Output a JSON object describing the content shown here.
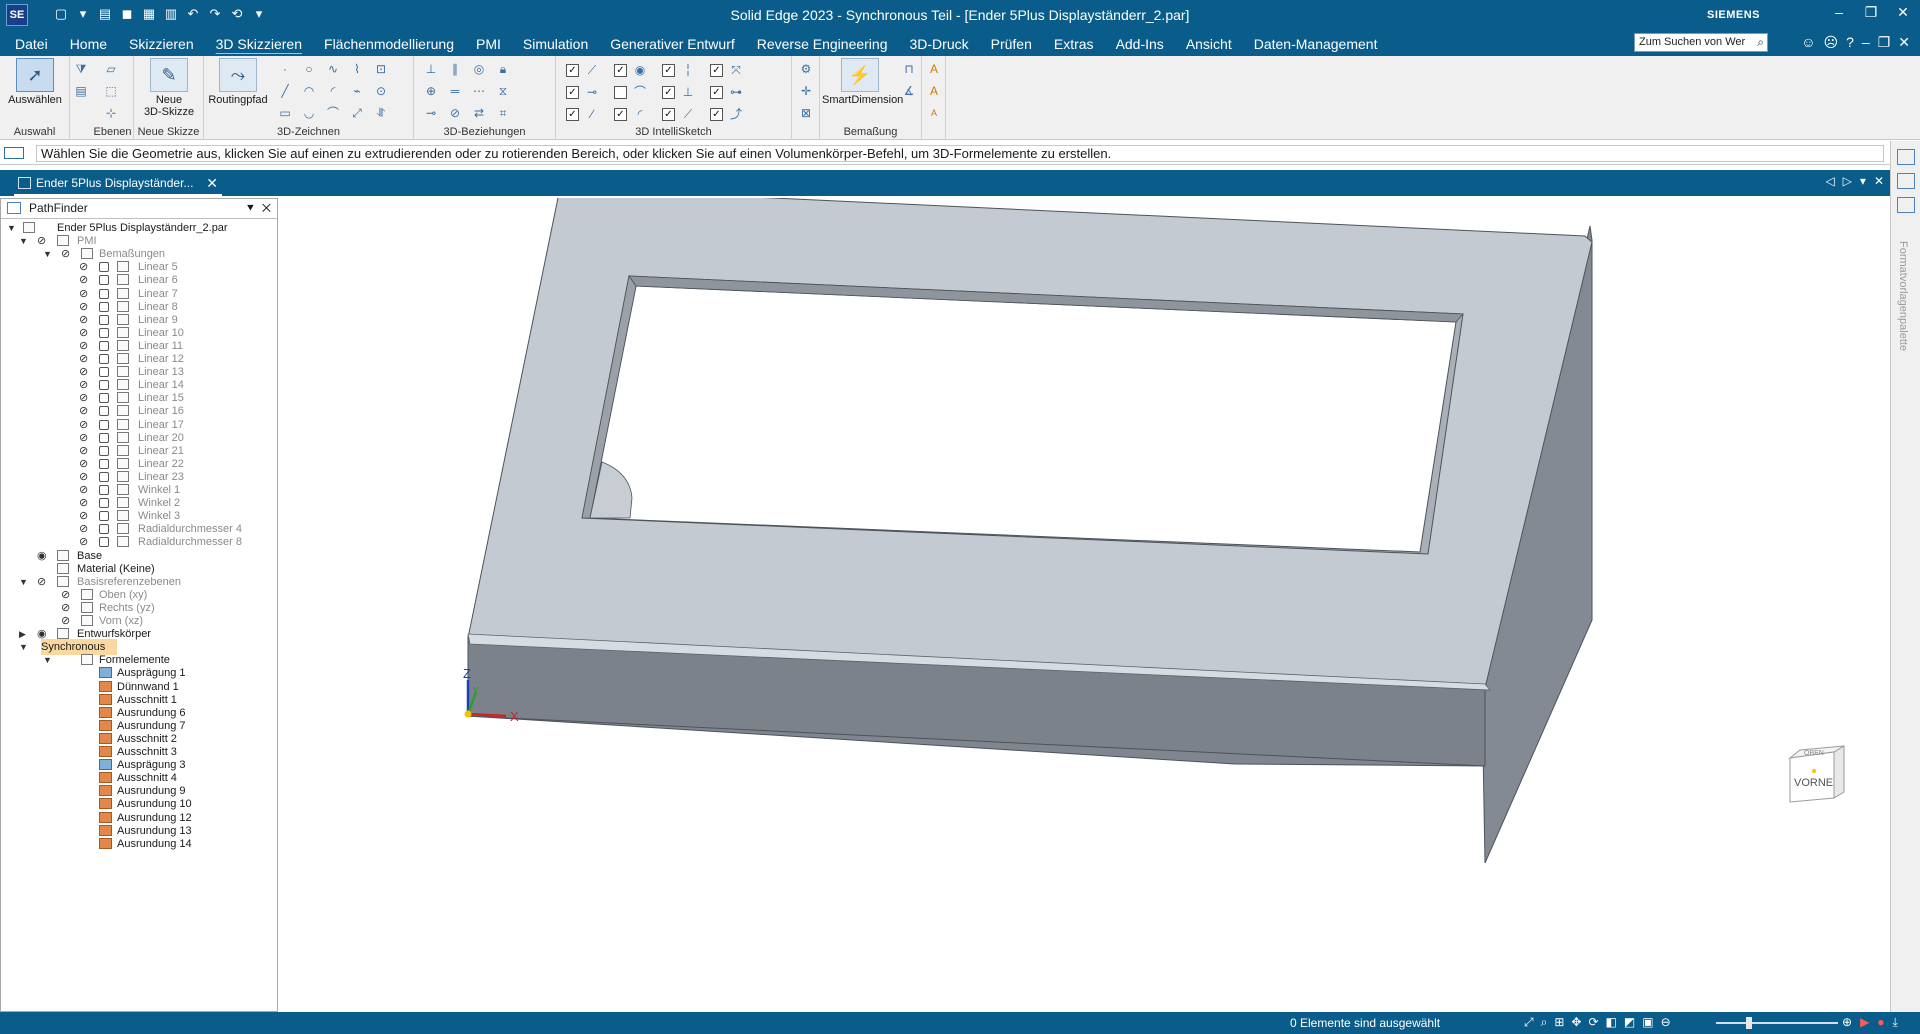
{
  "app": {
    "logo": "SE",
    "window_title": "Solid Edge 2023 - Synchronous Teil - [Ender 5Plus Displayständerr_2.par]",
    "brand": "SIEMENS"
  },
  "menu": {
    "tabs": [
      "Datei",
      "Home",
      "Skizzieren",
      "3D Skizzieren",
      "Flächenmodellierung",
      "PMI",
      "Simulation",
      "Generativer Entwurf",
      "Reverse Engineering",
      "3D-Druck",
      "Prüfen",
      "Extras",
      "Add-Ins",
      "Ansicht",
      "Daten-Management"
    ],
    "active_tab": "3D Skizzieren",
    "search_placeholder": "Zum Suchen von Wer"
  },
  "ribbon": {
    "groups": {
      "auswahl": "Auswahl",
      "ebenen": "Ebenen",
      "neue_skizze": "Neue Skizze",
      "zeichnen": "3D-Zeichnen",
      "beziehungen": "3D-Beziehungen",
      "intellisketch": "3D IntelliSketch",
      "bemassung": "Bemaßung"
    },
    "buttons": {
      "auswaehlen": "Auswählen",
      "neue_3d_skizze_line1": "Neue",
      "neue_3d_skizze_line2": "3D-Skizze",
      "routingpfad": "Routingpfad",
      "smartdimension": "SmartDimension"
    }
  },
  "prompt": {
    "message": "Wählen Sie die Geometrie aus, klicken Sie auf einen zu extrudierenden oder zu rotierenden Bereich, oder klicken Sie auf einen Volumenkörper-Befehl, um 3D-Formelemente zu erstellen."
  },
  "doc_tab": {
    "label": "Ender 5Plus Displayständer..."
  },
  "pathfinder": {
    "title": "PathFinder",
    "root": "Ender 5Plus Displayständerr_2.par",
    "pmi": "PMI",
    "bemassungen": "Bemaßungen",
    "dimensions": [
      "Linear 5",
      "Linear 6",
      "Linear 7",
      "Linear 8",
      "Linear 9",
      "Linear 10",
      "Linear 11",
      "Linear 12",
      "Linear 13",
      "Linear 14",
      "Linear 15",
      "Linear 16",
      "Linear 17",
      "Linear 20",
      "Linear 21",
      "Linear 22",
      "Linear 23",
      "Winkel 1",
      "Winkel 2",
      "Winkel 3",
      "Radialdurchmesser 4",
      "Radialdurchmesser 8"
    ],
    "base": "Base",
    "material": "Material (Keine)",
    "basisreferenzebenen": "Basisreferenzebenen",
    "planes": [
      "Oben (xy)",
      "Rechts (yz)",
      "Vorn (xz)"
    ],
    "entwurfskoerper": "Entwurfskörper",
    "synchronous": "Synchronous",
    "formelemente": "Formelemente",
    "features": [
      {
        "label": "Ausprägung 1",
        "kind": "protrusion"
      },
      {
        "label": "Dünnwand 1",
        "kind": "cut"
      },
      {
        "label": "Ausschnitt 1",
        "kind": "cut"
      },
      {
        "label": "Ausrundung 6",
        "kind": "cut"
      },
      {
        "label": "Ausrundung 7",
        "kind": "cut"
      },
      {
        "label": "Ausschnitt 2",
        "kind": "cut"
      },
      {
        "label": "Ausschnitt 3",
        "kind": "cut"
      },
      {
        "label": "Ausprägung 3",
        "kind": "protrusion"
      },
      {
        "label": "Ausschnitt 4",
        "kind": "cut"
      },
      {
        "label": "Ausrundung 9",
        "kind": "cut"
      },
      {
        "label": "Ausrundung 10",
        "kind": "cut"
      },
      {
        "label": "Ausrundung 12",
        "kind": "cut"
      },
      {
        "label": "Ausrundung 13",
        "kind": "cut"
      },
      {
        "label": "Ausrundung 14",
        "kind": "cut"
      }
    ]
  },
  "viewport": {
    "axis_x": "X",
    "axis_y": "Y",
    "axis_z": "Z",
    "viewcube_front": "VORNE",
    "viewcube_top": "OBEN"
  },
  "right_strip": {
    "label": "Formatvorlagenpalette"
  },
  "status": {
    "selection": "0 Elemente sind ausgewählt"
  }
}
